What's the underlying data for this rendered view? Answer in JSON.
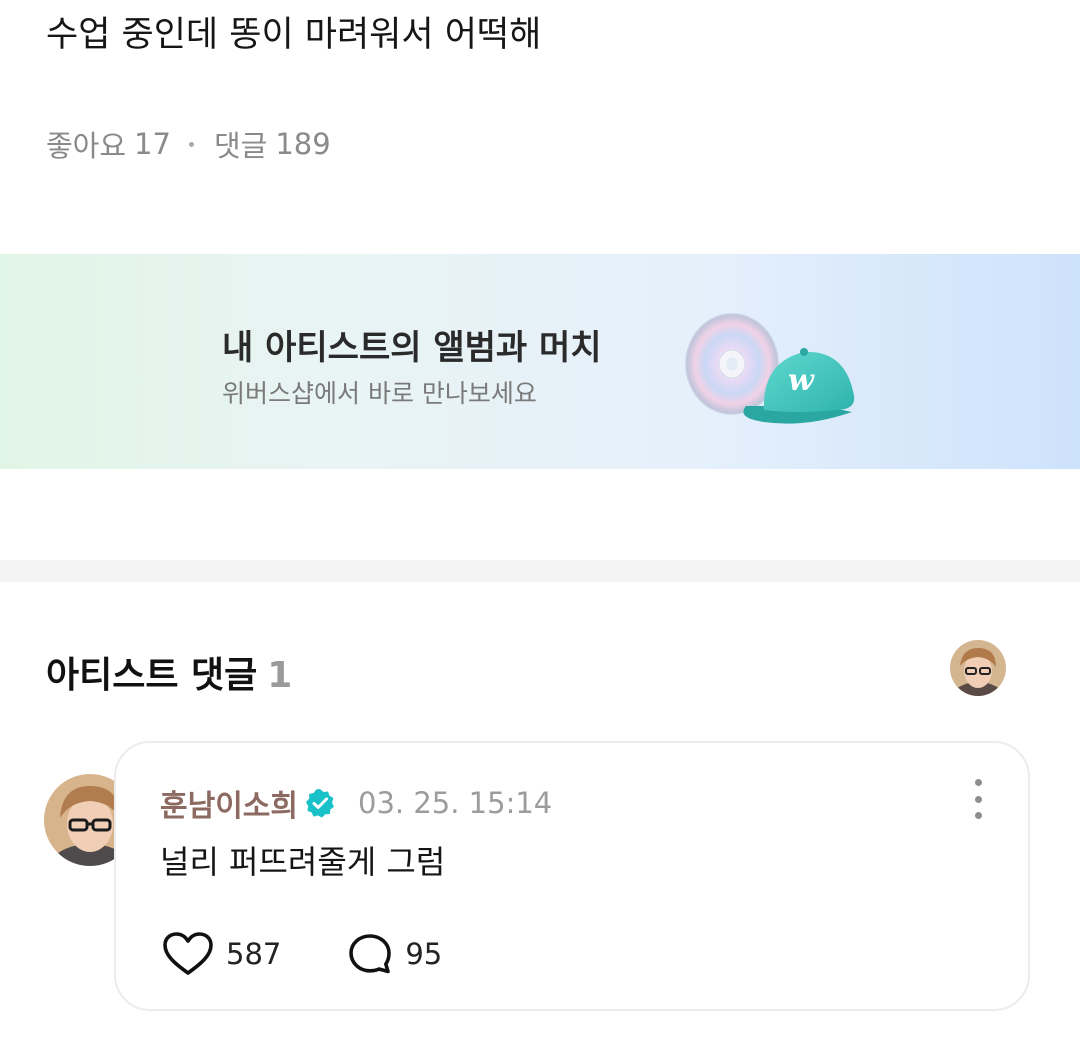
{
  "post": {
    "title": "수업 중인데 똥이 마려워서 어떡해",
    "likes_label": "좋아요",
    "likes_count": "17",
    "comments_label": "댓글",
    "comments_count": "189"
  },
  "banner": {
    "headline": "내 아티스트의 앨범과 머치",
    "subtext": "위버스샵에서 바로 만나보세요",
    "art_icons": [
      "cd-icon",
      "cap-icon"
    ],
    "cap_logo": "w",
    "colors": {
      "cap": "#41c9c0",
      "gradient_start": "#e1f5e6",
      "gradient_end": "#cde2fb"
    }
  },
  "artist_comments": {
    "title": "아티스트 댓글",
    "count": "1",
    "comments": [
      {
        "author": "훈남이소희",
        "verified": true,
        "timestamp": "03. 25. 15:14",
        "text": "널리 퍼뜨려줄게 그럼",
        "likes": "587",
        "replies": "95"
      }
    ]
  },
  "colors": {
    "author": "#8c6a62",
    "verified_badge": "#19c2c9",
    "muted_text": "#8a8a8a"
  }
}
